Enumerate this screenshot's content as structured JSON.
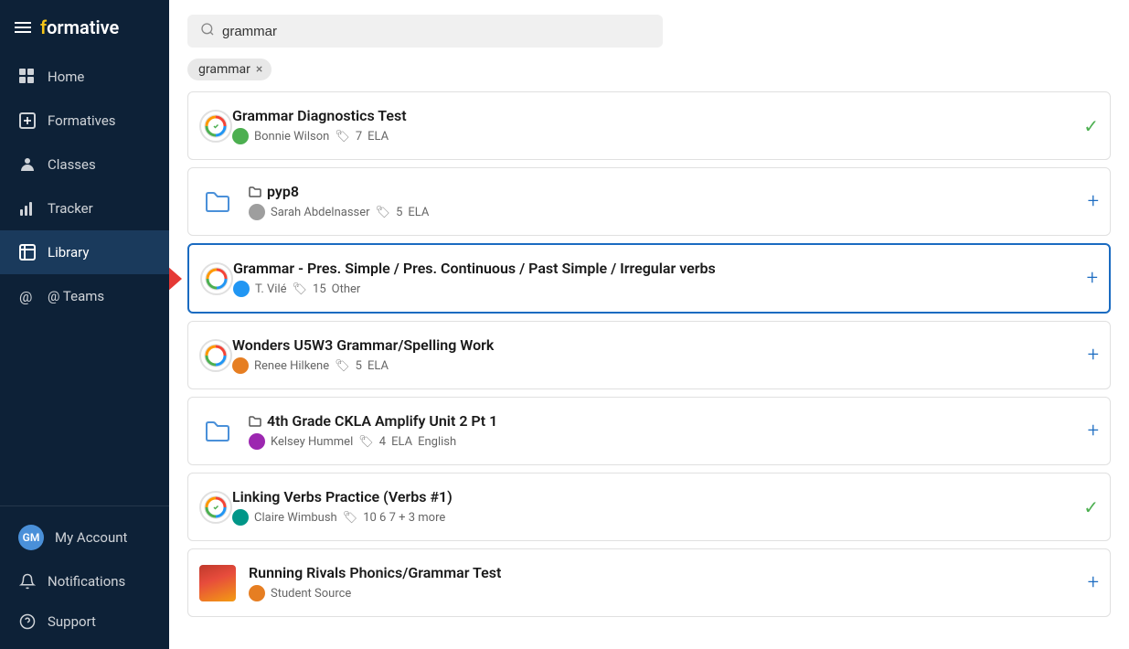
{
  "sidebar": {
    "logo": "formative",
    "hamburger_label": "menu",
    "nav_items": [
      {
        "id": "home",
        "label": "Home",
        "icon": "grid-icon",
        "active": false
      },
      {
        "id": "formatives",
        "label": "Formatives",
        "icon": "formatives-icon",
        "active": false
      },
      {
        "id": "classes",
        "label": "Classes",
        "icon": "classes-icon",
        "active": false
      },
      {
        "id": "tracker",
        "label": "Tracker",
        "icon": "tracker-icon",
        "active": false
      },
      {
        "id": "library",
        "label": "Library",
        "icon": "library-icon",
        "active": true
      },
      {
        "id": "teams",
        "label": "@ Teams",
        "icon": "teams-icon",
        "active": false
      }
    ],
    "bottom_items": [
      {
        "id": "my-account",
        "label": "My Account",
        "icon": "avatar",
        "initials": "GM"
      },
      {
        "id": "notifications",
        "label": "Notifications",
        "icon": "bell-icon"
      },
      {
        "id": "support",
        "label": "Support",
        "icon": "help-icon"
      }
    ]
  },
  "search": {
    "placeholder": "grammar",
    "value": "grammar",
    "filter_tag": "grammar",
    "filter_close": "×"
  },
  "results": [
    {
      "id": 1,
      "title": "Grammar Diagnostics Test",
      "author": "Bonnie Wilson",
      "author_avatar_color": "green",
      "grade": "7",
      "subject": "ELA",
      "type": "formative",
      "action": "check",
      "highlighted": false
    },
    {
      "id": 2,
      "title": "pyp8",
      "author": "Sarah Abdelnasser",
      "author_avatar_color": "gray",
      "grade": "5",
      "subject": "ELA",
      "type": "folder",
      "action": "plus",
      "highlighted": false
    },
    {
      "id": 3,
      "title": "Grammar - Pres. Simple / Pres. Continuous / Past Simple / Irregular verbs",
      "author": "T. Vilé",
      "author_avatar_color": "blue",
      "grade": "15",
      "subject": "Other",
      "type": "formative",
      "action": "plus",
      "highlighted": true
    },
    {
      "id": 4,
      "title": "Wonders U5W3 Grammar/Spelling Work",
      "author": "Renee Hilkene",
      "author_avatar_color": "orange",
      "grade": "5",
      "subject": "ELA",
      "type": "formative",
      "action": "plus",
      "highlighted": false
    },
    {
      "id": 5,
      "title": "4th Grade CKLA Amplify Unit 2 Pt 1",
      "author": "Kelsey Hummel",
      "author_avatar_color": "purple",
      "grade": "4",
      "subjects": "ELA  English",
      "type": "folder",
      "action": "plus",
      "highlighted": false
    },
    {
      "id": 6,
      "title": "Linking Verbs Practice (Verbs #1)",
      "author": "Claire Wimbush",
      "author_avatar_color": "teal",
      "grades": "10  6  7  + 3 more",
      "type": "formative",
      "action": "check",
      "highlighted": false
    },
    {
      "id": 7,
      "title": "Running Rivals Phonics/Grammar Test",
      "author": "Student Source",
      "author_avatar_color": "orange",
      "type": "thumbnail",
      "action": "plus",
      "highlighted": false
    }
  ],
  "colors": {
    "sidebar_bg": "#0d2137",
    "sidebar_active": "#1a3a5c",
    "accent_blue": "#1a6bc1",
    "check_green": "#4caf50",
    "highlight_border": "#1a6bc1",
    "arrow_red": "#e53935"
  }
}
